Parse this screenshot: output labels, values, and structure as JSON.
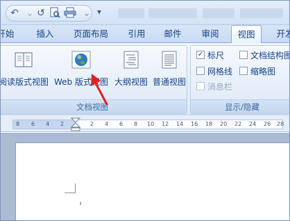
{
  "title_bar": {
    "qat_icons": [
      "undo-icon",
      "redo-icon",
      "print-preview-icon",
      "print-icon",
      "customize-qat-icon"
    ]
  },
  "tabs": [
    {
      "label": "开始"
    },
    {
      "label": "插入"
    },
    {
      "label": "页面布局"
    },
    {
      "label": "引用"
    },
    {
      "label": "邮件"
    },
    {
      "label": "审阅"
    },
    {
      "label": "视图",
      "active": true
    },
    {
      "label": "开发"
    }
  ],
  "ribbon": {
    "document_views": {
      "label": "文档视图",
      "buttons": [
        {
          "label": "阅读版式视图",
          "icon": "reading-layout-icon"
        },
        {
          "label": "Web 版式视图",
          "icon": "web-layout-globe-icon"
        },
        {
          "label": "大纲视图",
          "icon": "outline-view-icon"
        },
        {
          "label": "普通视图",
          "icon": "draft-view-icon"
        }
      ]
    },
    "show_hide": {
      "label": "显示/隐藏",
      "items": [
        {
          "label": "标尺",
          "checked": true,
          "enabled": true
        },
        {
          "label": "文档结构图",
          "checked": false,
          "enabled": true
        },
        {
          "label": "网格线",
          "checked": false,
          "enabled": true
        },
        {
          "label": "缩略图",
          "checked": false,
          "enabled": true
        },
        {
          "label": "消息栏",
          "checked": false,
          "enabled": false
        }
      ]
    }
  },
  "ruler": {
    "ticks": [
      "8",
      "6",
      "4",
      "2",
      "2",
      "4",
      "6",
      "8",
      "10",
      "12",
      "14",
      "16",
      "18",
      "20",
      "22",
      "24",
      "26",
      "28"
    ]
  },
  "colors": {
    "ribbon_text": "#15428b",
    "arrow": "#e02020"
  }
}
